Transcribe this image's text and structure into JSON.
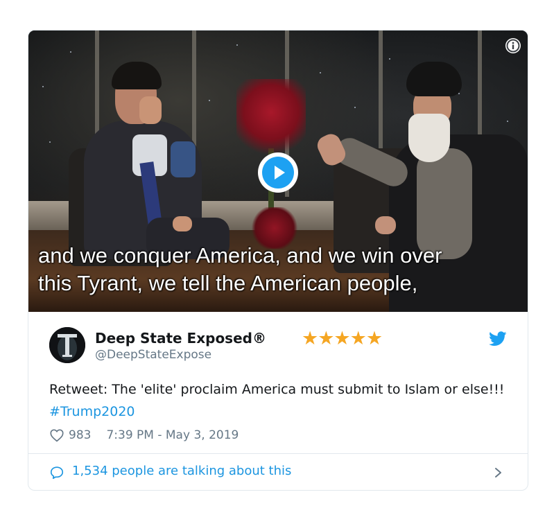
{
  "video": {
    "caption_line1": "and we conquer America, and we win over",
    "caption_line2": "this Tyrant, we tell the American people,",
    "play_icon": "play-icon",
    "info_icon": "info-icon"
  },
  "tweet": {
    "display_name": "Deep State Exposed®",
    "rating_stars": "★★★★★",
    "handle": "@DeepStateExpose",
    "text": "Retweet: The 'elite' proclaim America must submit to Islam or else!!! ",
    "hashtag": "#Trump2020",
    "like_count": "983",
    "timestamp": "7:39 PM - May 3, 2019",
    "icons": [
      "twitter-bird-icon",
      "heart-icon"
    ]
  },
  "footer": {
    "talking_text": "1,534 people are talking about this",
    "icons": [
      "speech-bubble-icon",
      "chevron-right-icon"
    ]
  },
  "colors": {
    "accent": "#1da1f2",
    "link": "#1b95e0",
    "star": "#f5a623",
    "muted": "#657786",
    "text": "#14171a",
    "border": "#e1e8ed"
  }
}
